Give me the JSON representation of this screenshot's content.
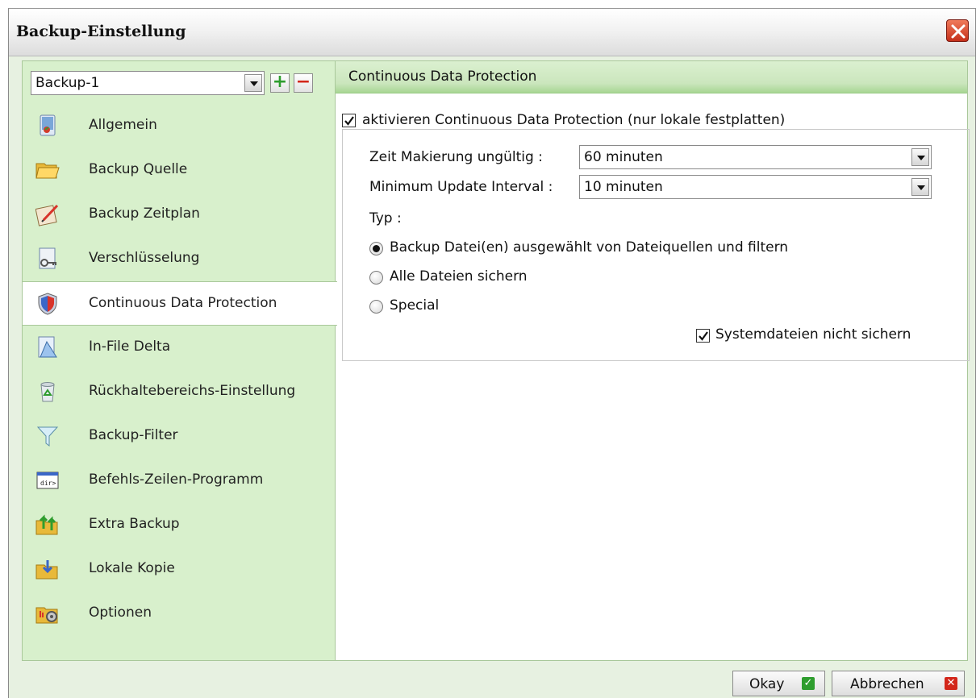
{
  "window": {
    "title": "Backup-Einstellung"
  },
  "profile": {
    "selected": "Backup-1",
    "add_label": "+",
    "remove_label": "−"
  },
  "sidebar": {
    "items": [
      {
        "label": "Allgemein",
        "icon": "general-icon"
      },
      {
        "label": "Backup Quelle",
        "icon": "folder-icon"
      },
      {
        "label": "Backup Zeitplan",
        "icon": "schedule-icon"
      },
      {
        "label": "Verschlüsselung",
        "icon": "encryption-key-icon"
      },
      {
        "label": "Continuous Data Protection",
        "icon": "shield-icon"
      },
      {
        "label": "In-File Delta",
        "icon": "delta-icon"
      },
      {
        "label": "Rückhaltebereichs-Einstellung",
        "icon": "recycle-bin-icon"
      },
      {
        "label": "Backup-Filter",
        "icon": "filter-icon"
      },
      {
        "label": "Befehls-Zeilen-Programm",
        "icon": "command-line-icon"
      },
      {
        "label": "Extra Backup",
        "icon": "extra-backup-icon"
      },
      {
        "label": "Lokale Kopie",
        "icon": "local-copy-icon"
      },
      {
        "label": "Optionen",
        "icon": "options-icon"
      }
    ],
    "active_index": 4
  },
  "panel": {
    "header": "Continuous Data Protection",
    "enable_label": "aktivieren Continuous Data Protection (nur lokale festplatten)",
    "enable_checked": true,
    "mark_invalid_label": "Zeit Makierung ungültig :",
    "mark_invalid_value": "60 minuten",
    "min_interval_label": "Minimum Update Interval :",
    "min_interval_value": "10 minuten",
    "type_label": "Typ :",
    "types": [
      {
        "label": "Backup Datei(en) ausgewählt von Dateiquellen und filtern",
        "selected": true
      },
      {
        "label": "Alle Dateien sichern",
        "selected": false
      },
      {
        "label": "Special",
        "selected": false
      }
    ],
    "exclude_system_label": "Systemdateien nicht sichern",
    "exclude_system_checked": true
  },
  "buttons": {
    "ok": "Okay",
    "cancel": "Abbrechen"
  },
  "colors": {
    "accent_green": "#2e9d2e",
    "cancel_red": "#d3261a",
    "panel_green": "#d8f0cc"
  }
}
